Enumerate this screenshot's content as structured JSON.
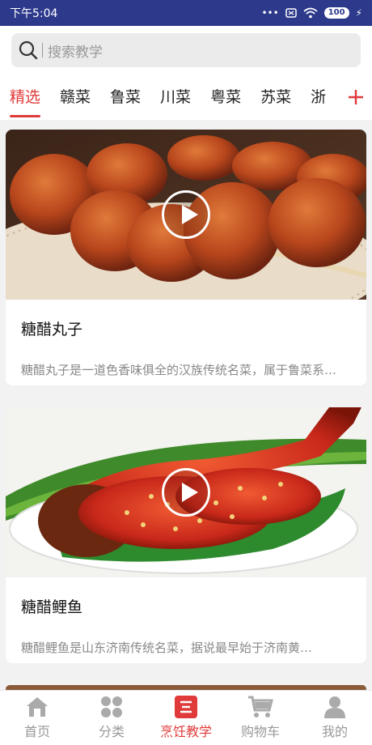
{
  "status": {
    "time": "下午5:04",
    "battery": "100"
  },
  "search": {
    "placeholder": "搜索教学"
  },
  "tabs": [
    {
      "label": "精选"
    },
    {
      "label": "赣菜"
    },
    {
      "label": "鲁菜"
    },
    {
      "label": "川菜"
    },
    {
      "label": "粤菜"
    },
    {
      "label": "苏菜"
    },
    {
      "label": "浙"
    }
  ],
  "cards": [
    {
      "title": "糖醋丸子",
      "desc": "糖醋丸子是一道色香味俱全的汉族传统名菜，属于鲁菜系…"
    },
    {
      "title": "糖醋鲤鱼",
      "desc": "糖醋鲤鱼是山东济南传统名菜，据说最早始于济南黄…"
    }
  ],
  "nav": [
    {
      "label": "首页",
      "icon": "home-icon"
    },
    {
      "label": "分类",
      "icon": "category-icon"
    },
    {
      "label": "烹饪教学",
      "icon": "cooking-icon"
    },
    {
      "label": "购物车",
      "icon": "cart-icon"
    },
    {
      "label": "我的",
      "icon": "user-icon"
    }
  ],
  "colors": {
    "accent": "#e03a3a",
    "statusbar": "#2d3a8c"
  }
}
